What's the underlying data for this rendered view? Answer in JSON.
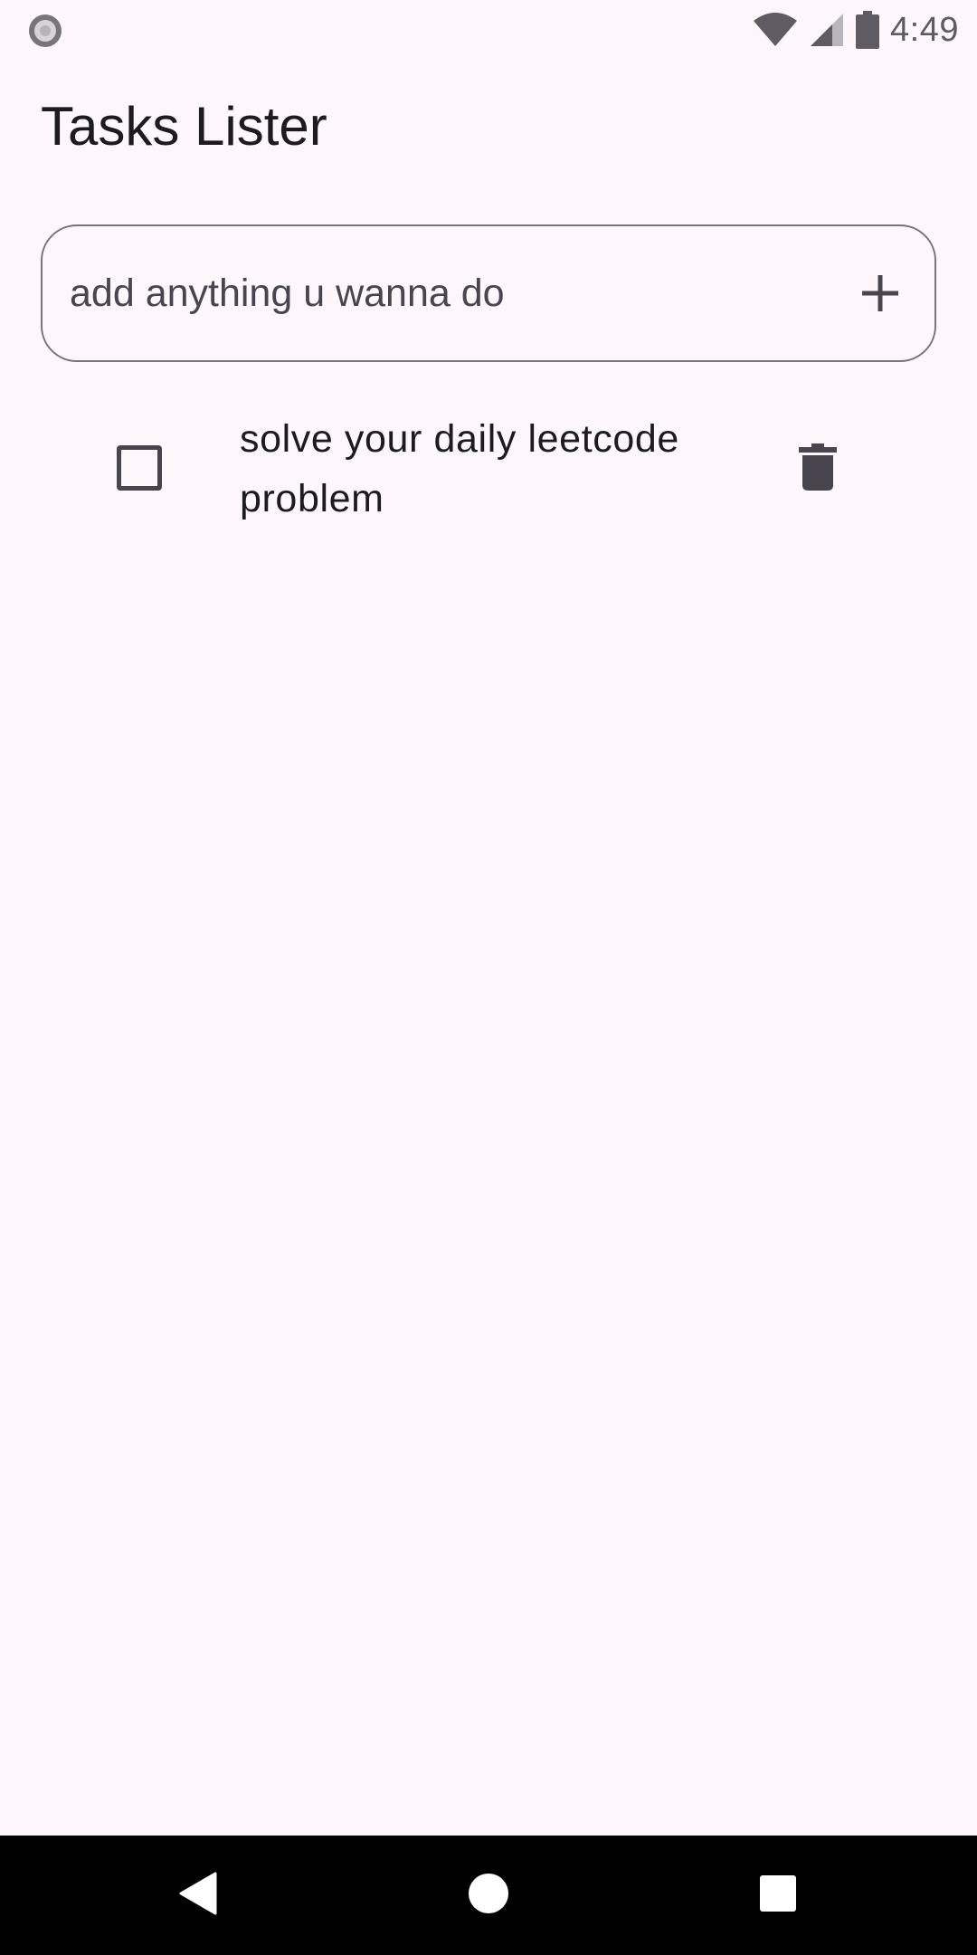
{
  "status_bar": {
    "time": "4:49",
    "icons": [
      "record-indicator-icon",
      "wifi-icon",
      "cell-signal-icon",
      "battery-icon"
    ]
  },
  "app": {
    "title": "Tasks Lister"
  },
  "input": {
    "placeholder": "add anything u wanna do",
    "value": "",
    "add_icon": "plus-icon"
  },
  "tasks": [
    {
      "text": "solve your daily leetcode problem",
      "checked": false,
      "delete_icon": "trash-icon"
    }
  ],
  "nav_bar": {
    "buttons": [
      "back-icon",
      "home-icon",
      "recents-icon"
    ]
  },
  "colors": {
    "background": "#FDF7FC",
    "text": "#1D1B20",
    "icon": "#49454F",
    "outline": "#79747E",
    "nav_bar": "#000000"
  }
}
